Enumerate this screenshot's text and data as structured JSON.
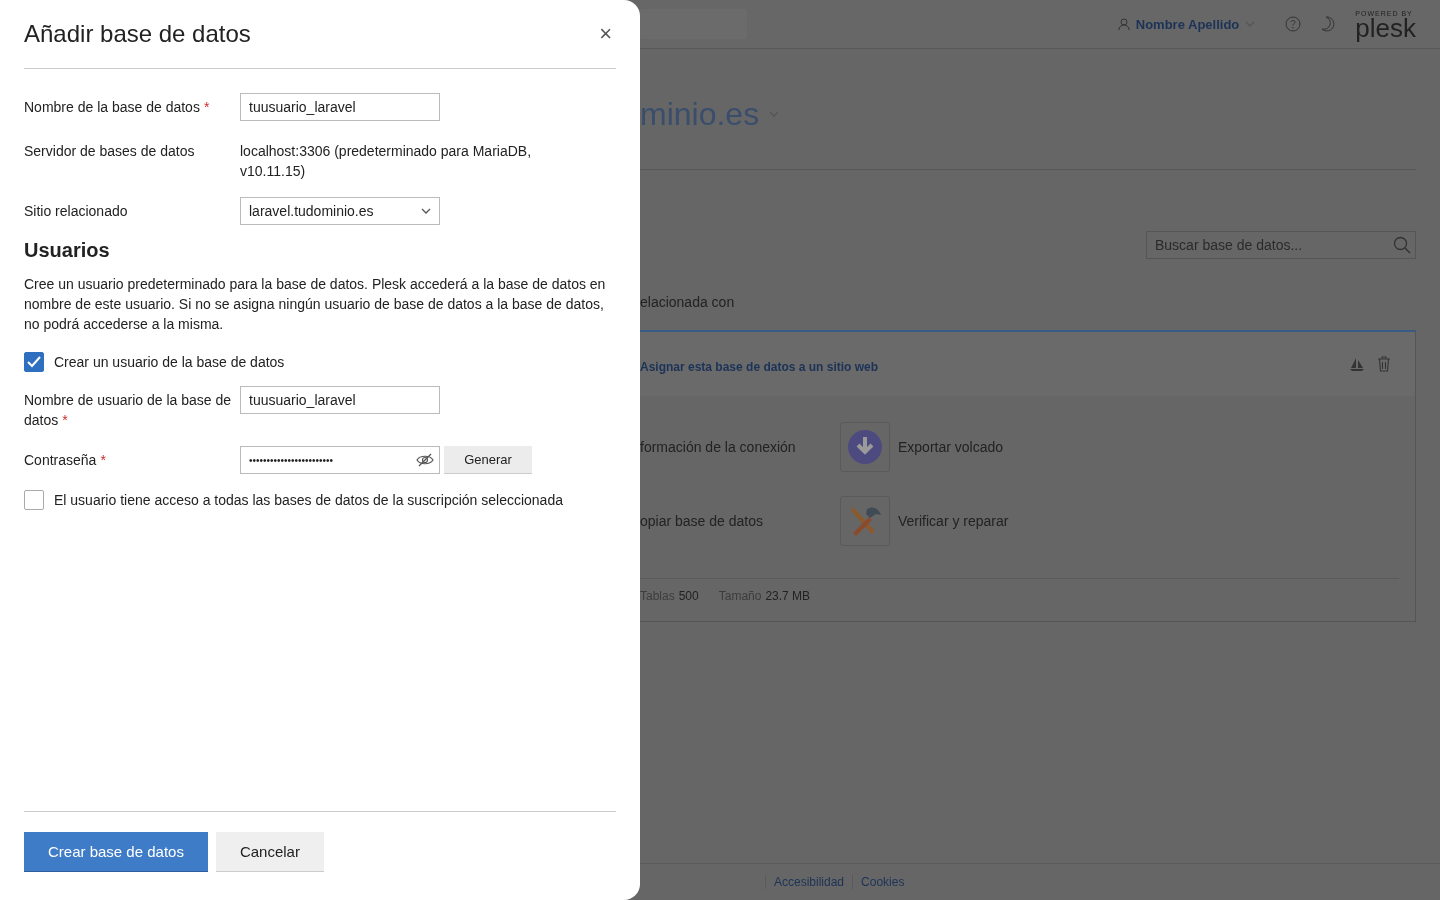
{
  "page": {
    "header": {
      "user_name": "Nombre Apellido",
      "brand_top": "POWERED BY",
      "brand": "plesk"
    },
    "title": "minio.es",
    "search": {
      "placeholder": "Buscar base de datos..."
    },
    "filter_label": "elacionada con",
    "card": {
      "link": "Asignar esta base de datos a un sitio web",
      "actions": [
        {
          "kind": "text",
          "label": "formación de la conexión"
        },
        {
          "kind": "download",
          "label": "Exportar volcado"
        },
        {
          "kind": "text",
          "label": "opiar base de datos"
        },
        {
          "kind": "tools",
          "label": "Verificar y reparar"
        }
      ],
      "stats": [
        {
          "label": "Tablas",
          "value": "500"
        },
        {
          "label": "Tamaño",
          "value": "23.7 MB"
        }
      ]
    },
    "footer_links": [
      "Accesibilidad",
      "Cookies"
    ]
  },
  "dialog": {
    "title": "Añadir base de datos",
    "close": "×",
    "fields": [
      {
        "kind": "text",
        "label": "Nombre de la base de datos",
        "required_mark": "*",
        "value": "tuusuario_laravel"
      },
      {
        "kind": "static",
        "label": "Servidor de bases de datos",
        "value": "localhost:3306 (predeterminado para MariaDB, v10.11.15)"
      },
      {
        "kind": "select",
        "label": "Sitio relacionado",
        "value": "laravel.tudominio.es"
      }
    ],
    "users": {
      "heading": "Usuarios",
      "description": "Cree un usuario predeterminado para la base de datos. Plesk accederá a la base de datos en nombre de este usuario. Si no se asigna ningún usuario de base de datos a la base de datos, no podrá accederse a la misma.",
      "create_user": {
        "label": "Crear un usuario de la base de datos",
        "checked": true
      },
      "fields": [
        {
          "kind": "text",
          "label": "Nombre de usuario de la base de datos",
          "required_mark": "*",
          "value": "tuusuario_laravel"
        },
        {
          "kind": "password",
          "label": "Contraseña",
          "required_mark": "*",
          "value": "••••••••••••••••••••••••",
          "button": "Generar"
        }
      ],
      "all_access": {
        "label": "El usuario tiene acceso a todas las bases de datos de la suscripción seleccionada",
        "checked": false
      }
    },
    "buttons": [
      {
        "kind": "primary",
        "label": "Crear base de datos"
      },
      {
        "kind": "secondary",
        "label": "Cancelar"
      }
    ]
  }
}
